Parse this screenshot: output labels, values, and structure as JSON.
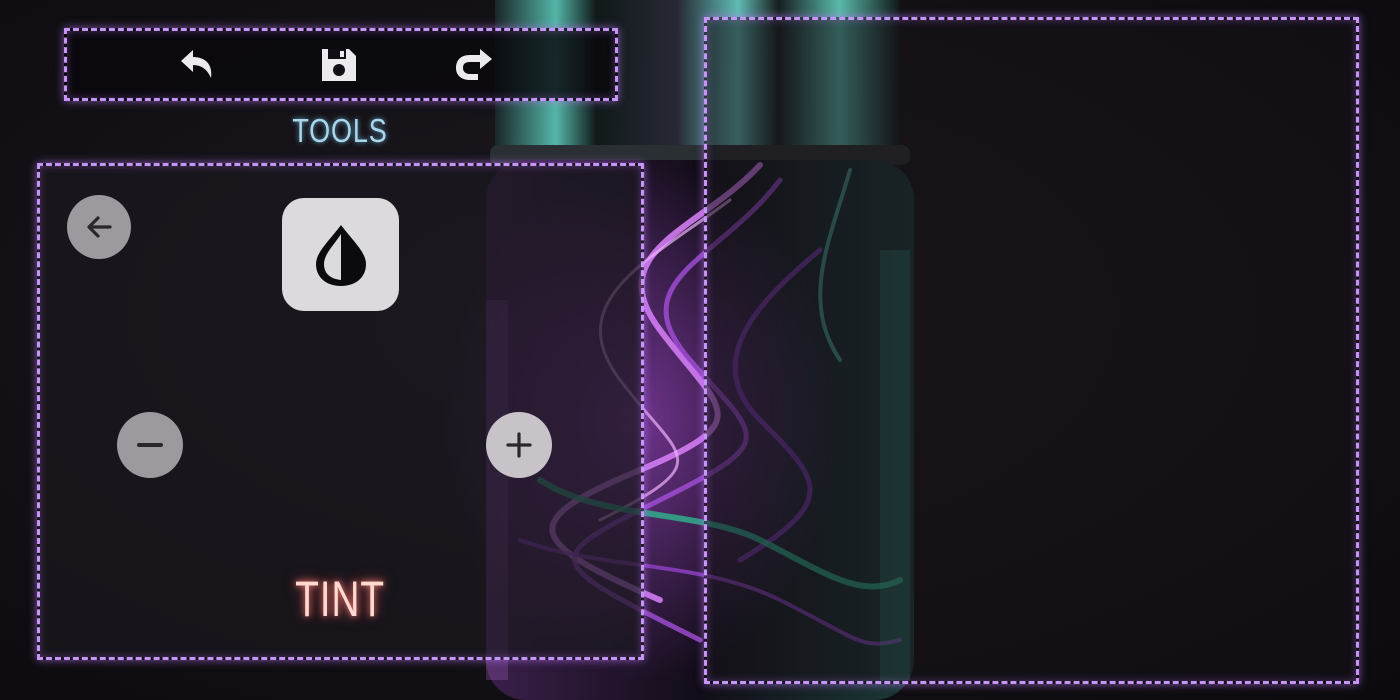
{
  "toolbar": {
    "buttons": [
      {
        "id": "undo",
        "icon": "undo-icon"
      },
      {
        "id": "save",
        "icon": "save-icon"
      },
      {
        "id": "redo",
        "icon": "redo-icon"
      }
    ]
  },
  "tools_panel": {
    "title": "TOOLS",
    "active_tool_label": "TINT",
    "active_tool_icon": "drop-icon",
    "back_icon": "arrow-left-icon",
    "decrease_icon": "minus-icon",
    "increase_icon": "plus-icon"
  },
  "colors": {
    "neon_outline": "#c596f5",
    "title_text": "#a8d6ea",
    "tint_text": "#ffd9cf",
    "button_fill": "#9d9a9f",
    "tile_fill": "#dcdadd"
  }
}
